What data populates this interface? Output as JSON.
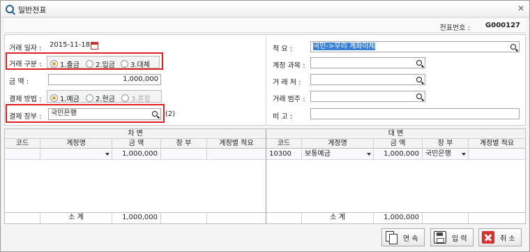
{
  "window": {
    "title": "일반전표",
    "close_glyph": "✕"
  },
  "doc": {
    "number_label": "전표번호 :",
    "number_value": "G000127"
  },
  "left_form": {
    "date_label": "거래 일자 :",
    "date_value": "2015-11-18",
    "type_label": "거래 구분 :",
    "type_options": [
      "1.출금",
      "2.입금",
      "3.대체"
    ],
    "type_selected": "1.출금",
    "amount_label": "금      액 :",
    "amount_value": "1,000,000",
    "payment_label": "결제 방법 :",
    "payment_options": [
      "1.예금",
      "2.현금",
      "3.혼합"
    ],
    "payment_selected": "1.예금",
    "book_label": "결제 장부 :",
    "book_value": "국민은행",
    "book_note": "(2)"
  },
  "right_form": {
    "summary_label": "적      요 :",
    "summary_value": "국민->우리 계좌이체",
    "account_label": "계정 과목 :",
    "account_value": "",
    "partner_label": "거  래  처 :",
    "partner_value": "",
    "category_label": "거래 범주 :",
    "category_value": "",
    "memo_label": "비      고 :",
    "memo_value": ""
  },
  "grid": {
    "debit": {
      "title": "차    변",
      "columns": [
        "코드",
        "계정명",
        "금  액",
        "장 부",
        "계정별 적요"
      ],
      "rows": [
        {
          "code": "",
          "account": "",
          "amount": "1,000,000",
          "book": "",
          "note": ""
        }
      ],
      "footer": {
        "label": "소    계",
        "amount": "1,000,000"
      }
    },
    "credit": {
      "title": "대    변",
      "columns": [
        "코드",
        "계정명",
        "금  액",
        "장 부",
        "계정별 적요"
      ],
      "rows": [
        {
          "code": "10300",
          "account": "보통예금",
          "amount": "1,000,000",
          "book": "국민은행",
          "note": ""
        }
      ],
      "footer": {
        "label": "소    계",
        "amount": "1,000,000"
      }
    }
  },
  "buttons": {
    "continue": "연 속",
    "save": "입 력",
    "cancel": "취 소"
  },
  "colors": {
    "highlight_red": "#e02020",
    "selection_blue": "#3b7fd9",
    "radio_on": "#e2a82a"
  }
}
